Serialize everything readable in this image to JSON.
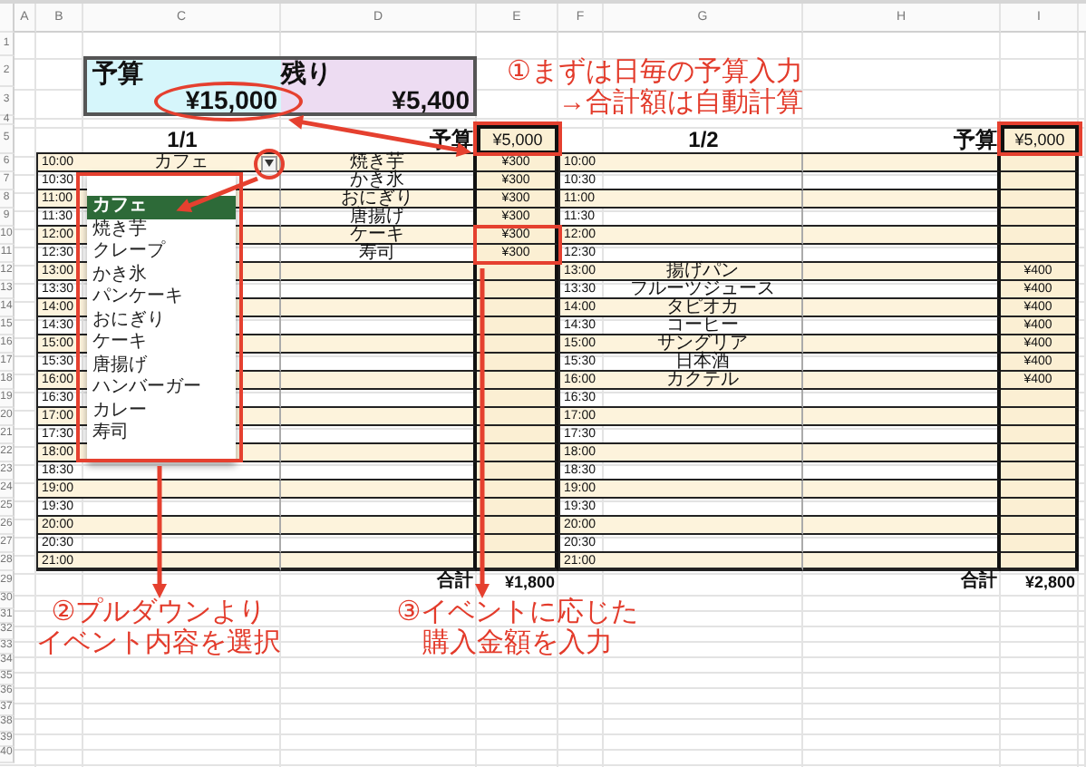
{
  "column_headers": [
    "A",
    "B",
    "C",
    "D",
    "E",
    "F",
    "G",
    "H",
    "I"
  ],
  "row_numbers": [
    "1",
    "2",
    "3",
    "4",
    "5",
    "6",
    "7",
    "8",
    "9",
    "10",
    "11",
    "12",
    "13",
    "14",
    "15",
    "16",
    "17",
    "18",
    "19",
    "20",
    "21",
    "22",
    "23",
    "24",
    "25",
    "26",
    "27",
    "28",
    "29",
    "30",
    "31",
    "32",
    "33",
    "34",
    "35",
    "36",
    "37",
    "38",
    "39",
    "40"
  ],
  "summary": {
    "budget_label": "予算",
    "budget_value": "¥15,000",
    "remaining_label": "残り",
    "remaining_value": "¥5,400"
  },
  "days": [
    {
      "date": "1/1",
      "budget_label": "予算",
      "budget": "¥5,000",
      "total_label": "合計",
      "total": "¥1,800",
      "rows": [
        {
          "time": "10:00",
          "event": "カフェ",
          "item": "焼き芋",
          "amount": "¥300"
        },
        {
          "time": "10:30",
          "item": "かき氷",
          "amount": "¥300"
        },
        {
          "time": "11:00",
          "item": "おにぎり",
          "amount": "¥300"
        },
        {
          "time": "11:30",
          "item": "唐揚げ",
          "amount": "¥300"
        },
        {
          "time": "12:00",
          "item": "ケーキ",
          "amount": "¥300"
        },
        {
          "time": "12:30",
          "item": "寿司",
          "amount": "¥300"
        },
        {
          "time": "13:00"
        },
        {
          "time": "13:30"
        },
        {
          "time": "14:00"
        },
        {
          "time": "14:30"
        },
        {
          "time": "15:00"
        },
        {
          "time": "15:30"
        },
        {
          "time": "16:00"
        },
        {
          "time": "16:30"
        },
        {
          "time": "17:00"
        },
        {
          "time": "17:30"
        },
        {
          "time": "18:00"
        },
        {
          "time": "18:30"
        },
        {
          "time": "19:00"
        },
        {
          "time": "19:30"
        },
        {
          "time": "20:00"
        },
        {
          "time": "20:30"
        },
        {
          "time": "21:00"
        }
      ]
    },
    {
      "date": "1/2",
      "budget_label": "予算",
      "budget": "¥5,000",
      "total_label": "合計",
      "total": "¥2,800",
      "rows": [
        {
          "time": "10:00"
        },
        {
          "time": "10:30"
        },
        {
          "time": "11:00"
        },
        {
          "time": "11:30"
        },
        {
          "time": "12:00"
        },
        {
          "time": "12:30"
        },
        {
          "time": "13:00",
          "event": "揚げパン",
          "amount": "¥400"
        },
        {
          "time": "13:30",
          "event": "フルーツジュース",
          "amount": "¥400"
        },
        {
          "time": "14:00",
          "event": "タピオカ",
          "amount": "¥400"
        },
        {
          "time": "14:30",
          "event": "コーヒー",
          "amount": "¥400"
        },
        {
          "time": "15:00",
          "event": "サングリア",
          "amount": "¥400"
        },
        {
          "time": "15:30",
          "event": "日本酒",
          "amount": "¥400"
        },
        {
          "time": "16:00",
          "event": "カクテル",
          "amount": "¥400"
        },
        {
          "time": "16:30"
        },
        {
          "time": "17:00"
        },
        {
          "time": "17:30"
        },
        {
          "time": "18:00"
        },
        {
          "time": "18:30"
        },
        {
          "time": "19:00"
        },
        {
          "time": "19:30"
        },
        {
          "time": "20:00"
        },
        {
          "time": "20:30"
        },
        {
          "time": "21:00"
        }
      ]
    }
  ],
  "dropdown": {
    "items": [
      {
        "label": "カフェ",
        "selected": true
      },
      {
        "label": "焼き芋",
        "selected": false
      },
      {
        "label": "クレープ",
        "selected": false
      },
      {
        "label": "かき氷",
        "selected": false
      },
      {
        "label": "パンケーキ",
        "selected": false
      },
      {
        "label": "おにぎり",
        "selected": false
      },
      {
        "label": "ケーキ",
        "selected": false
      },
      {
        "label": "唐揚げ",
        "selected": false
      },
      {
        "label": "ハンバーガー",
        "selected": false
      },
      {
        "label": "カレー",
        "selected": false
      },
      {
        "label": "寿司",
        "selected": false
      }
    ]
  },
  "annotations": [
    {
      "lines": [
        "①まずは日毎の予算入力",
        "→合計額は自動計算"
      ]
    },
    {
      "lines": [
        "②プルダウンより",
        "イベント内容を選択"
      ]
    },
    {
      "lines": [
        "③イベントに応じた",
        "購入金額を入力"
      ]
    }
  ]
}
